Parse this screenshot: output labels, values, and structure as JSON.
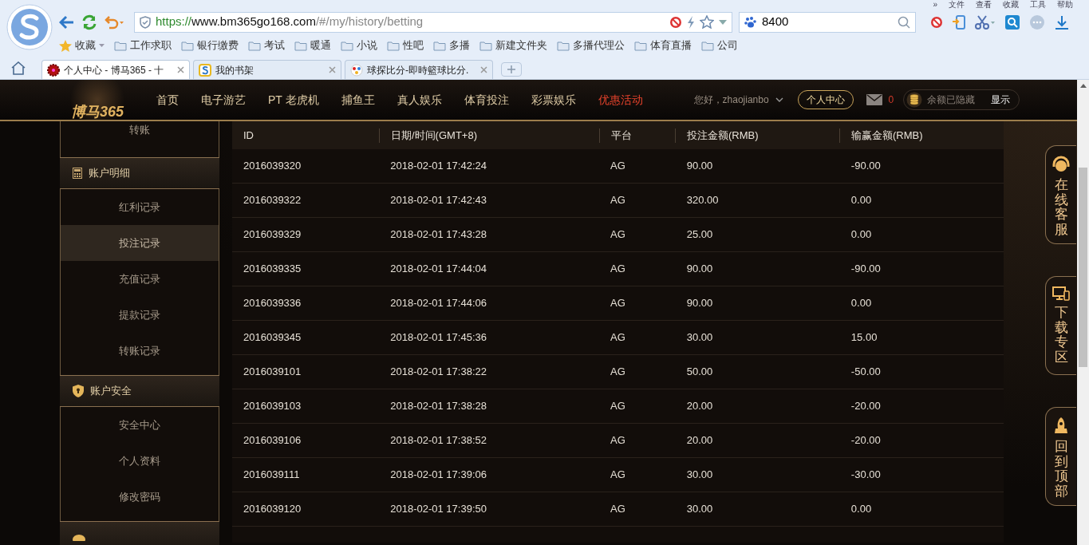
{
  "browser": {
    "menu": [
      "»",
      "文件",
      "查看",
      "收藏",
      "工具",
      "帮助"
    ],
    "url": {
      "scheme": "https://",
      "host": "www.bm365go168.com",
      "path": "/#/my/history/betting"
    },
    "search": {
      "value": "8400"
    },
    "bookmarks": [
      {
        "label": "收藏",
        "kind": "star"
      },
      {
        "label": "工作求职",
        "kind": "folder"
      },
      {
        "label": "银行缴费",
        "kind": "folder"
      },
      {
        "label": "考试",
        "kind": "folder"
      },
      {
        "label": "暖通",
        "kind": "folder"
      },
      {
        "label": "小说",
        "kind": "folder"
      },
      {
        "label": "性吧",
        "kind": "folder"
      },
      {
        "label": "多播",
        "kind": "folder"
      },
      {
        "label": "新建文件夹",
        "kind": "folder"
      },
      {
        "label": "多播代理公",
        "kind": "folder"
      },
      {
        "label": "体育直播",
        "kind": "folder"
      },
      {
        "label": "公司",
        "kind": "folder"
      }
    ],
    "tabs": [
      {
        "title": "个人中心 - 博马365 - 十",
        "selected": true
      },
      {
        "title": "我的书架",
        "selected": false
      },
      {
        "title": "球探比分-即時籃球比分.",
        "selected": false
      }
    ]
  },
  "site": {
    "logo": "博马365",
    "nav": [
      {
        "label": "首页",
        "highlighted": false
      },
      {
        "label": "电子游艺",
        "highlighted": false
      },
      {
        "label": "PT 老虎机",
        "highlighted": false
      },
      {
        "label": "捕鱼王",
        "highlighted": false
      },
      {
        "label": "真人娱乐",
        "highlighted": false
      },
      {
        "label": "体育投注",
        "highlighted": false
      },
      {
        "label": "彩票娱乐",
        "highlighted": false
      },
      {
        "label": "优惠活动",
        "highlighted": true
      }
    ],
    "greeting": "您好，zhaojianbo",
    "account_button": "个人中心",
    "messages": "0",
    "balance": "余额已隐藏",
    "show_button": "显示"
  },
  "sidebar": [
    {
      "kind": "link",
      "label": "转账",
      "selected": false
    },
    {
      "kind": "header",
      "label": "账户明细"
    },
    {
      "kind": "link",
      "label": "红利记录",
      "selected": false
    },
    {
      "kind": "link",
      "label": "投注记录",
      "selected": true
    },
    {
      "kind": "link",
      "label": "充值记录",
      "selected": false
    },
    {
      "kind": "link",
      "label": "提款记录",
      "selected": false
    },
    {
      "kind": "link",
      "label": "转账记录",
      "selected": false
    },
    {
      "kind": "header",
      "label": "账户安全"
    },
    {
      "kind": "link",
      "label": "安全中心",
      "selected": false
    },
    {
      "kind": "link",
      "label": "个人资料",
      "selected": false
    },
    {
      "kind": "link",
      "label": "修改密码",
      "selected": false
    },
    {
      "kind": "header"
    }
  ],
  "table": {
    "columns": [
      "ID",
      "日期/时间(GMT+8)",
      "平台",
      "投注金额(RMB)",
      "输赢金额(RMB)"
    ],
    "rows": [
      [
        "2016039320",
        "2018-02-01 17:42:24",
        "AG",
        "90.00",
        "-90.00"
      ],
      [
        "2016039322",
        "2018-02-01 17:42:43",
        "AG",
        "320.00",
        "0.00"
      ],
      [
        "2016039329",
        "2018-02-01 17:43:28",
        "AG",
        "25.00",
        "0.00"
      ],
      [
        "2016039335",
        "2018-02-01 17:44:04",
        "AG",
        "90.00",
        "-90.00"
      ],
      [
        "2016039336",
        "2018-02-01 17:44:06",
        "AG",
        "90.00",
        "0.00"
      ],
      [
        "2016039345",
        "2018-02-01 17:45:36",
        "AG",
        "30.00",
        "15.00"
      ],
      [
        "2016039101",
        "2018-02-01 17:38:22",
        "AG",
        "50.00",
        "-50.00"
      ],
      [
        "2016039103",
        "2018-02-01 17:38:28",
        "AG",
        "20.00",
        "-20.00"
      ],
      [
        "2016039106",
        "2018-02-01 17:38:52",
        "AG",
        "20.00",
        "-20.00"
      ],
      [
        "2016039111",
        "2018-02-01 17:39:06",
        "AG",
        "30.00",
        "-30.00"
      ],
      [
        "2016039120",
        "2018-02-01 17:39:50",
        "AG",
        "30.00",
        "0.00"
      ]
    ]
  },
  "float_buttons": [
    "在线客服",
    "下载专区",
    "回到顶部"
  ]
}
